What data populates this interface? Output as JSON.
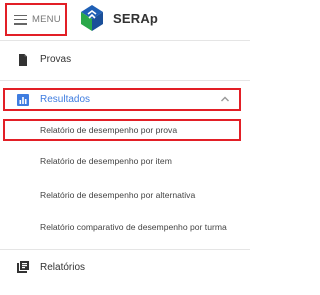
{
  "header": {
    "menu_label": "MENU",
    "brand": "SERAp"
  },
  "nav": {
    "provas": {
      "label": "Provas",
      "icon": "document-icon"
    },
    "resultados": {
      "label": "Resultados",
      "icon": "bar-chart-icon",
      "expanded": true,
      "color": "#3f7de0",
      "items": [
        {
          "label": "Relatório de desempenho por prova"
        },
        {
          "label": "Relatório de desempenho por item"
        },
        {
          "label": "Relatório de desempenho por alternativa"
        },
        {
          "label": "Relatório comparativo de desempenho por turma"
        }
      ]
    },
    "relatorios": {
      "label": "Relatórios",
      "icon": "library-books-icon"
    }
  },
  "colors": {
    "highlight_border": "#e21f26",
    "accent": "#3f7de0",
    "logo_blue": "#1e5fb5",
    "logo_green": "#2aa84a"
  }
}
